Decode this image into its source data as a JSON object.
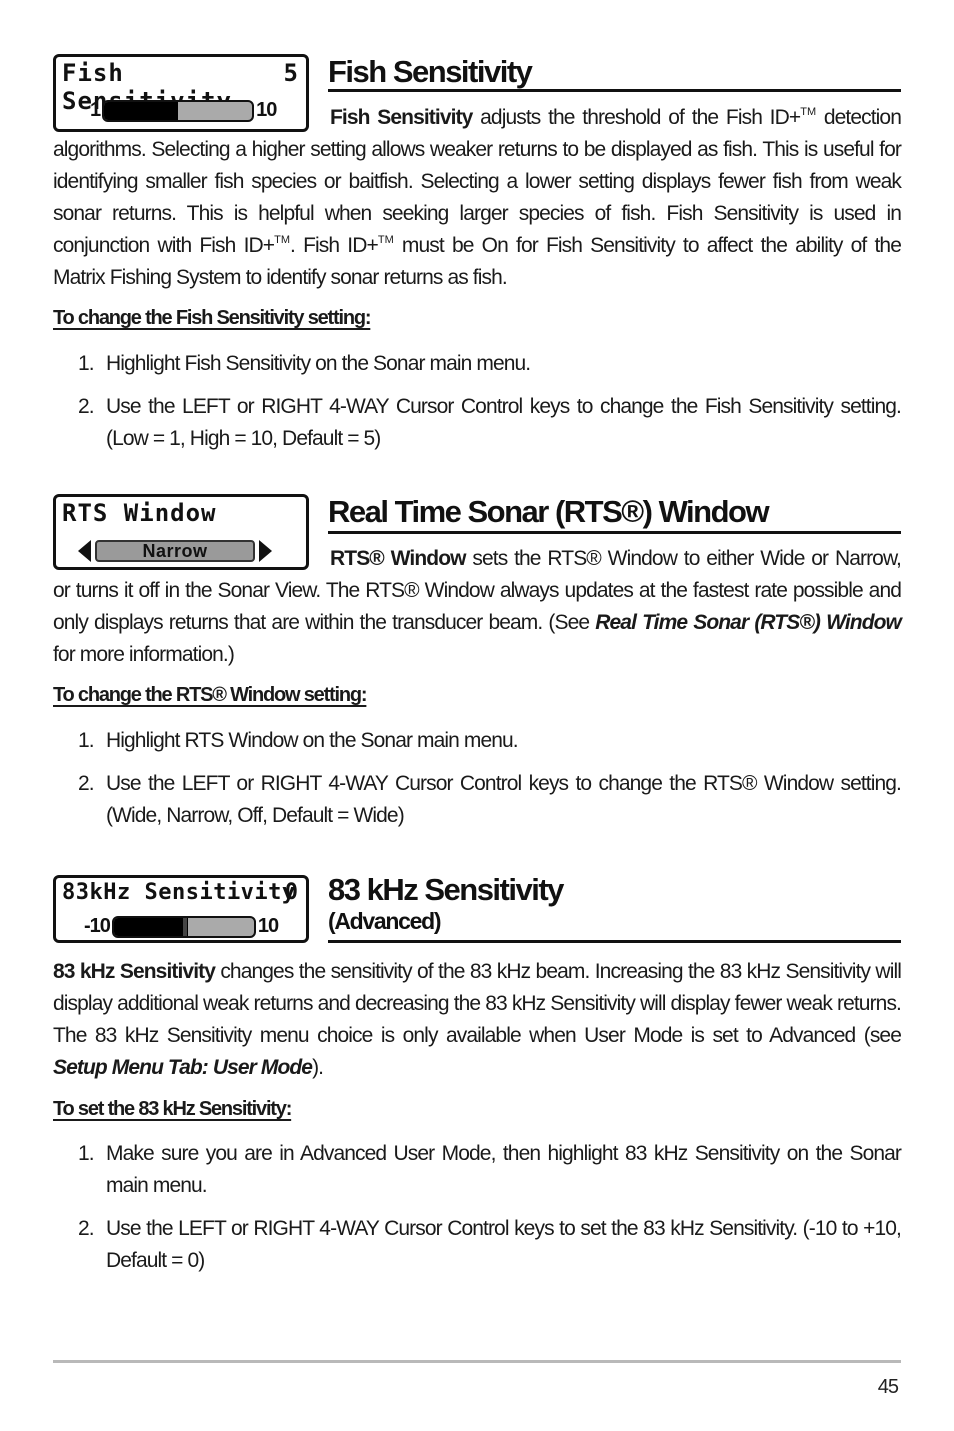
{
  "sections": [
    {
      "id": "fish-sensitivity",
      "heading": "Fish Sensitivity",
      "widget": {
        "title": "Fish Sensitivity",
        "value": "5",
        "min_label": "1",
        "max_label": "10",
        "min": 1,
        "max": 10,
        "current": 5
      },
      "intro_term": "Fish Sensitivity",
      "intro_text_1": " adjusts the threshold of the Fish ID+",
      "tm": "TM",
      "intro_text_2": " detection algorithms.  Selecting a higher setting allows weaker returns to be displayed as fish.  This is useful for identifying smaller fish species or baitfish.  Selecting a lower setting displays fewer fish from weak sonar returns.  This is helpful when seeking larger species of fish. Fish Sensitivity is used in conjunction with Fish ID+",
      "intro_text_3": ". Fish ID+",
      "intro_text_4": " must be On for Fish Sensitivity to affect the ability of the  Matrix Fishing System to identify sonar returns as fish.",
      "procedure_title": "To change the Fish Sensitivity setting:",
      "steps": [
        {
          "num": "1.",
          "text": "Highlight Fish Sensitivity on the Sonar main menu."
        },
        {
          "num": "2.",
          "text": "Use the LEFT or RIGHT 4-WAY Cursor Control keys to change the Fish Sensitivity setting. (Low = 1, High = 10, Default = 5)"
        }
      ]
    },
    {
      "id": "rts-window",
      "heading": "Real Time Sonar (RTS®) Window",
      "widget": {
        "title": "RTS Window",
        "selected": "Narrow"
      },
      "intro_term": "RTS® Window",
      "intro_text_1": " sets the RTS® Window to either Wide or Narrow, or turns it off in the Sonar View. The RTS® Window always updates at the fastest rate possible and only displays returns that are within the transducer beam. (See ",
      "intro_ref": "Real Time Sonar (RTS®) Window",
      "intro_text_2": " for more information.)",
      "procedure_title": "To change the RTS® Window setting:",
      "steps": [
        {
          "num": "1.",
          "text": "Highlight RTS Window on the Sonar main menu."
        },
        {
          "num": "2.",
          "text": "Use the LEFT or RIGHT 4-WAY Cursor Control keys to change the RTS® Window setting. (Wide, Narrow, Off, Default = Wide)"
        }
      ]
    },
    {
      "id": "83khz-sensitivity",
      "heading": "83 kHz Sensitivity",
      "subheading": "(Advanced)",
      "widget": {
        "title": "83kHz Sensitivity",
        "value": "0",
        "min_label": "-10",
        "max_label": "10",
        "min": -10,
        "max": 10,
        "current": 0
      },
      "intro_term": "83 kHz Sensitivity",
      "intro_text_1": " changes the sensitivity of the 83 kHz beam.  Increasing the 83 kHz Sensitivity will display additional weak returns and decreasing the 83 kHz Sensitivity will display fewer weak returns. The 83 kHz Sensitivity menu choice is only available when User Mode is set to Advanced (see ",
      "intro_ref": "Setup Menu Tab: User Mode",
      "intro_text_2": ").",
      "procedure_title": "To set the 83 kHz Sensitivity:",
      "steps": [
        {
          "num": "1.",
          "text": "Make sure you are in Advanced User Mode, then highlight 83 kHz Sensitivity on the Sonar main menu."
        },
        {
          "num": "2.",
          "text": "Use the LEFT or RIGHT 4-WAY Cursor Control keys to set the 83 kHz Sensitivity. (-10 to +10, Default = 0)"
        }
      ]
    }
  ],
  "footer": {
    "page_number": "45"
  }
}
